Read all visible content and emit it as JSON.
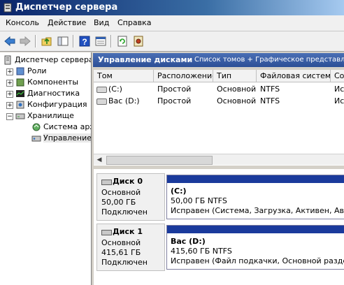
{
  "window": {
    "title": "Диспетчер сервера"
  },
  "menu": [
    "Консоль",
    "Действие",
    "Вид",
    "Справка"
  ],
  "toolbar": {
    "icons": [
      "back-icon",
      "forward-icon",
      "up-folder-icon",
      "show-hide-tree-icon",
      "help-icon",
      "properties-icon",
      "refresh-icon",
      "settings-icon"
    ]
  },
  "tree": {
    "root": "Диспетчер сервера",
    "items": [
      "Роли",
      "Компоненты",
      "Диагностика",
      "Конфигурация",
      "Хранилище"
    ],
    "storage_children": [
      "Система архи",
      "Управление"
    ]
  },
  "header": {
    "title": "Управление дисками",
    "subtitle": "Список томов + Графическое представлени"
  },
  "columns": [
    "Том",
    "Расположение",
    "Тип",
    "Файловая система",
    "Сост"
  ],
  "volumes": [
    {
      "name": "(C:)",
      "layout": "Простой",
      "type": "Основной",
      "fs": "NTFS",
      "status": "Исп"
    },
    {
      "name": "Вас (D:)",
      "layout": "Простой",
      "type": "Основной",
      "fs": "NTFS",
      "status": "Исп"
    }
  ],
  "disks": [
    {
      "title": "Диск 0",
      "kind": "Основной",
      "size": "50,00 ГБ",
      "state": "Подключен",
      "part_name": "(C:)",
      "part_size": "50,00 ГБ NTFS",
      "part_status": "Исправен (Система, Загрузка, Активен, Аварийн"
    },
    {
      "title": "Диск 1",
      "kind": "Основной",
      "size": "415,61 ГБ",
      "state": "Подключен",
      "part_name": "Вас  (D:)",
      "part_size": "415,60 ГБ NTFS",
      "part_status": "Исправен (Файл подкачки, Основной раздел)"
    }
  ],
  "colors": {
    "title_bar": "#0a246a",
    "header_strip": "#2c4f96",
    "partition_bar": "#1a3a9c"
  }
}
